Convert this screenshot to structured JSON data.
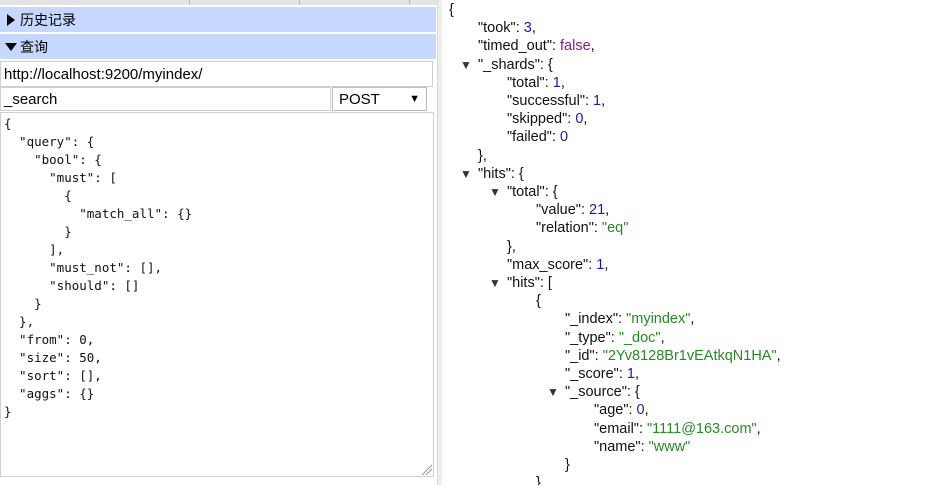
{
  "sidebar": {
    "history_label": "历史记录",
    "query_label": "查询"
  },
  "request": {
    "url": "http://localhost:9200/myindex/",
    "path": "_search",
    "method": "POST",
    "body_lines": [
      "{",
      "  \"query\": {",
      "    \"bool\": {",
      "      \"must\": [",
      "        {",
      "          \"match_all\": {}",
      "        }",
      "      ],",
      "      \"must_not\": [],",
      "      \"should\": []",
      "    }",
      "  },",
      "  \"from\": 0,",
      "  \"size\": 50,",
      "  \"sort\": [],",
      "  \"aggs\": {}",
      "}"
    ]
  },
  "response": {
    "lines": [
      {
        "indent": 0,
        "tokens": [
          [
            "p",
            "{"
          ]
        ]
      },
      {
        "indent": 1,
        "tokens": [
          [
            "k",
            "\"took\": "
          ],
          [
            "n",
            "3"
          ],
          [
            "p",
            ","
          ]
        ]
      },
      {
        "indent": 1,
        "tokens": [
          [
            "k",
            "\"timed_out\": "
          ],
          [
            "b",
            "false"
          ],
          [
            "p",
            ","
          ]
        ]
      },
      {
        "indent": 1,
        "fold": true,
        "tokens": [
          [
            "k",
            "\"_shards\": {"
          ]
        ]
      },
      {
        "indent": 2,
        "tokens": [
          [
            "k",
            "\"total\": "
          ],
          [
            "n",
            "1"
          ],
          [
            "p",
            ","
          ]
        ]
      },
      {
        "indent": 2,
        "tokens": [
          [
            "k",
            "\"successful\": "
          ],
          [
            "n",
            "1"
          ],
          [
            "p",
            ","
          ]
        ]
      },
      {
        "indent": 2,
        "tokens": [
          [
            "k",
            "\"skipped\": "
          ],
          [
            "n",
            "0"
          ],
          [
            "p",
            ","
          ]
        ]
      },
      {
        "indent": 2,
        "tokens": [
          [
            "k",
            "\"failed\": "
          ],
          [
            "n",
            "0"
          ]
        ]
      },
      {
        "indent": 1,
        "tokens": [
          [
            "p",
            "},"
          ]
        ]
      },
      {
        "indent": 1,
        "fold": true,
        "tokens": [
          [
            "k",
            "\"hits\": {"
          ]
        ]
      },
      {
        "indent": 2,
        "fold": true,
        "tokens": [
          [
            "k",
            "\"total\": {"
          ]
        ]
      },
      {
        "indent": 3,
        "tokens": [
          [
            "k",
            "\"value\": "
          ],
          [
            "n",
            "21"
          ],
          [
            "p",
            ","
          ]
        ]
      },
      {
        "indent": 3,
        "tokens": [
          [
            "k",
            "\"relation\": "
          ],
          [
            "s",
            "\"eq\""
          ]
        ]
      },
      {
        "indent": 2,
        "tokens": [
          [
            "p",
            "},"
          ]
        ]
      },
      {
        "indent": 2,
        "tokens": [
          [
            "k",
            "\"max_score\": "
          ],
          [
            "n",
            "1"
          ],
          [
            "p",
            ","
          ]
        ]
      },
      {
        "indent": 2,
        "fold": true,
        "tokens": [
          [
            "k",
            "\"hits\": ["
          ]
        ]
      },
      {
        "indent": 3,
        "tokens": [
          [
            "p",
            "{"
          ]
        ]
      },
      {
        "indent": 4,
        "tokens": [
          [
            "k",
            "\"_index\": "
          ],
          [
            "s",
            "\"myindex\""
          ],
          [
            "p",
            ","
          ]
        ]
      },
      {
        "indent": 4,
        "tokens": [
          [
            "k",
            "\"_type\": "
          ],
          [
            "s",
            "\"_doc\""
          ],
          [
            "p",
            ","
          ]
        ]
      },
      {
        "indent": 4,
        "tokens": [
          [
            "k",
            "\"_id\": "
          ],
          [
            "s",
            "\"2Yv8128Br1vEAtkqN1HA\""
          ],
          [
            "p",
            ","
          ]
        ]
      },
      {
        "indent": 4,
        "tokens": [
          [
            "k",
            "\"_score\": "
          ],
          [
            "n",
            "1"
          ],
          [
            "p",
            ","
          ]
        ]
      },
      {
        "indent": 4,
        "fold": true,
        "tokens": [
          [
            "k",
            "\"_source\": {"
          ]
        ]
      },
      {
        "indent": 5,
        "tokens": [
          [
            "k",
            "\"age\": "
          ],
          [
            "n",
            "0"
          ],
          [
            "p",
            ","
          ]
        ]
      },
      {
        "indent": 5,
        "tokens": [
          [
            "k",
            "\"email\": "
          ],
          [
            "s",
            "\"1111@163.com\""
          ],
          [
            "p",
            ","
          ]
        ]
      },
      {
        "indent": 5,
        "tokens": [
          [
            "k",
            "\"name\": "
          ],
          [
            "s",
            "\"www\""
          ]
        ]
      },
      {
        "indent": 4,
        "tokens": [
          [
            "p",
            "}"
          ]
        ]
      },
      {
        "indent": 3,
        "tokens": [
          [
            "p",
            "}"
          ]
        ]
      }
    ]
  }
}
